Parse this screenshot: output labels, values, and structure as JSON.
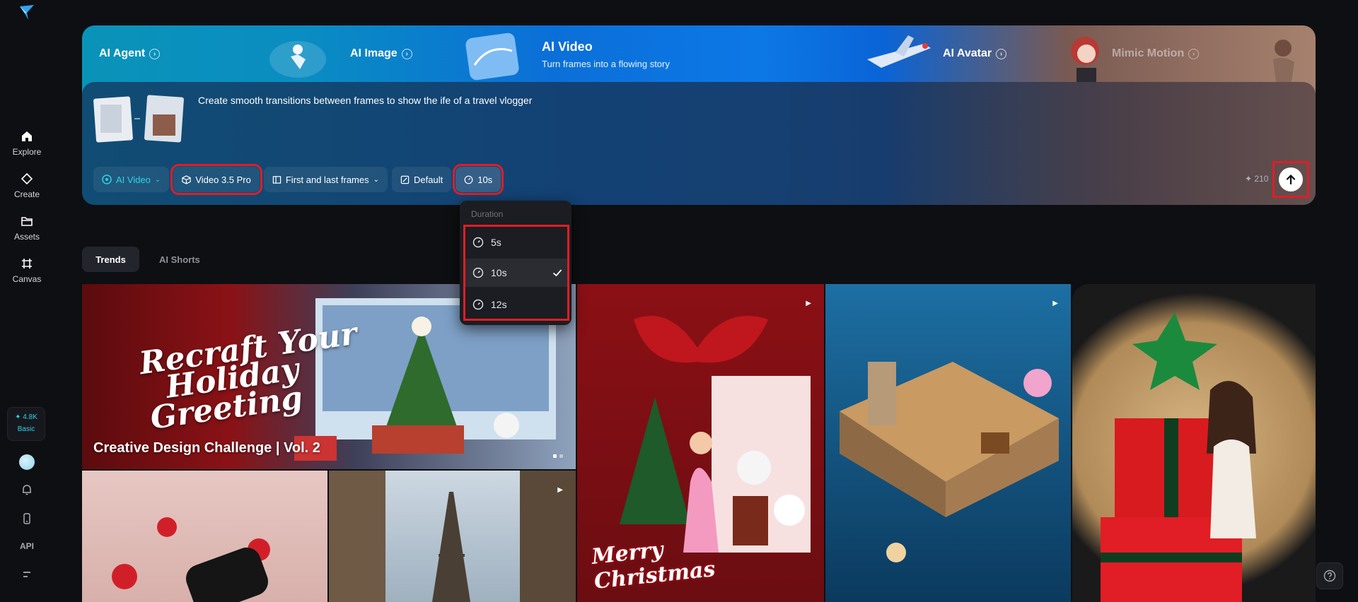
{
  "sidebar": {
    "items": [
      {
        "label": "Explore"
      },
      {
        "label": "Create"
      },
      {
        "label": "Assets"
      },
      {
        "label": "Canvas"
      }
    ],
    "credits": {
      "amount": "4.8K",
      "plan": "Basic"
    },
    "api_label": "API"
  },
  "hero": {
    "tabs": [
      {
        "label": "AI Agent"
      },
      {
        "label": "AI Image"
      },
      {
        "label": "AI Avatar"
      },
      {
        "label": "Mimic Motion"
      }
    ],
    "active": {
      "title": "AI Video",
      "subtitle": "Turn frames into a flowing story"
    },
    "prompt": "Create smooth transitions between frames to show the ife of a travel vlogger",
    "toolbar": {
      "mode": "AI Video",
      "model": "Video 3.5 Pro",
      "frames": "First and last frames",
      "ratio": "Default",
      "duration": "10s"
    },
    "cost": "210"
  },
  "duration_menu": {
    "title": "Duration",
    "options": [
      {
        "label": "5s",
        "selected": false
      },
      {
        "label": "10s",
        "selected": true
      },
      {
        "label": "12s",
        "selected": false
      }
    ]
  },
  "content_tabs": [
    {
      "label": "Trends",
      "active": true
    },
    {
      "label": "AI Shorts",
      "active": false
    }
  ],
  "gallery": {
    "featured": {
      "script_lines": [
        "Recraft Your",
        "Holiday",
        "Greeting"
      ],
      "title": "Creative Design Challenge | Vol. 2"
    },
    "christmas_card_text": [
      "Merry",
      "Christmas"
    ]
  },
  "colors": {
    "accent": "#2fd3e8",
    "highlight": "#e11d25",
    "background": "#0e0f12"
  }
}
